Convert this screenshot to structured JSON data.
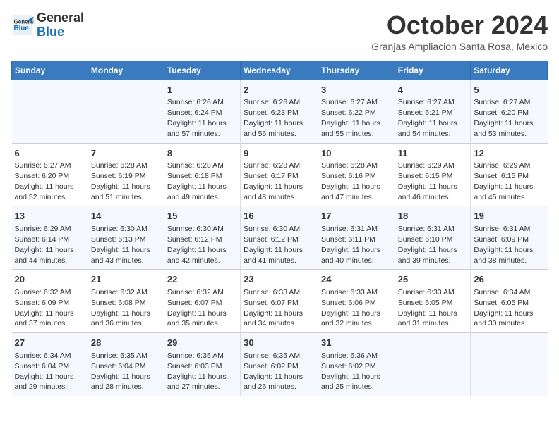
{
  "header": {
    "logo_line1": "General",
    "logo_line2": "Blue",
    "month": "October 2024",
    "location": "Granjas Ampliacion Santa Rosa, Mexico"
  },
  "weekdays": [
    "Sunday",
    "Monday",
    "Tuesday",
    "Wednesday",
    "Thursday",
    "Friday",
    "Saturday"
  ],
  "rows": [
    [
      {
        "day": "",
        "text": ""
      },
      {
        "day": "",
        "text": ""
      },
      {
        "day": "1",
        "text": "Sunrise: 6:26 AM\nSunset: 6:24 PM\nDaylight: 11 hours and 57 minutes."
      },
      {
        "day": "2",
        "text": "Sunrise: 6:26 AM\nSunset: 6:23 PM\nDaylight: 11 hours and 56 minutes."
      },
      {
        "day": "3",
        "text": "Sunrise: 6:27 AM\nSunset: 6:22 PM\nDaylight: 11 hours and 55 minutes."
      },
      {
        "day": "4",
        "text": "Sunrise: 6:27 AM\nSunset: 6:21 PM\nDaylight: 11 hours and 54 minutes."
      },
      {
        "day": "5",
        "text": "Sunrise: 6:27 AM\nSunset: 6:20 PM\nDaylight: 11 hours and 53 minutes."
      }
    ],
    [
      {
        "day": "6",
        "text": "Sunrise: 6:27 AM\nSunset: 6:20 PM\nDaylight: 11 hours and 52 minutes."
      },
      {
        "day": "7",
        "text": "Sunrise: 6:28 AM\nSunset: 6:19 PM\nDaylight: 11 hours and 51 minutes."
      },
      {
        "day": "8",
        "text": "Sunrise: 6:28 AM\nSunset: 6:18 PM\nDaylight: 11 hours and 49 minutes."
      },
      {
        "day": "9",
        "text": "Sunrise: 6:28 AM\nSunset: 6:17 PM\nDaylight: 11 hours and 48 minutes."
      },
      {
        "day": "10",
        "text": "Sunrise: 6:28 AM\nSunset: 6:16 PM\nDaylight: 11 hours and 47 minutes."
      },
      {
        "day": "11",
        "text": "Sunrise: 6:29 AM\nSunset: 6:15 PM\nDaylight: 11 hours and 46 minutes."
      },
      {
        "day": "12",
        "text": "Sunrise: 6:29 AM\nSunset: 6:15 PM\nDaylight: 11 hours and 45 minutes."
      }
    ],
    [
      {
        "day": "13",
        "text": "Sunrise: 6:29 AM\nSunset: 6:14 PM\nDaylight: 11 hours and 44 minutes."
      },
      {
        "day": "14",
        "text": "Sunrise: 6:30 AM\nSunset: 6:13 PM\nDaylight: 11 hours and 43 minutes."
      },
      {
        "day": "15",
        "text": "Sunrise: 6:30 AM\nSunset: 6:12 PM\nDaylight: 11 hours and 42 minutes."
      },
      {
        "day": "16",
        "text": "Sunrise: 6:30 AM\nSunset: 6:12 PM\nDaylight: 11 hours and 41 minutes."
      },
      {
        "day": "17",
        "text": "Sunrise: 6:31 AM\nSunset: 6:11 PM\nDaylight: 11 hours and 40 minutes."
      },
      {
        "day": "18",
        "text": "Sunrise: 6:31 AM\nSunset: 6:10 PM\nDaylight: 11 hours and 39 minutes."
      },
      {
        "day": "19",
        "text": "Sunrise: 6:31 AM\nSunset: 6:09 PM\nDaylight: 11 hours and 38 minutes."
      }
    ],
    [
      {
        "day": "20",
        "text": "Sunrise: 6:32 AM\nSunset: 6:09 PM\nDaylight: 11 hours and 37 minutes."
      },
      {
        "day": "21",
        "text": "Sunrise: 6:32 AM\nSunset: 6:08 PM\nDaylight: 11 hours and 36 minutes."
      },
      {
        "day": "22",
        "text": "Sunrise: 6:32 AM\nSunset: 6:07 PM\nDaylight: 11 hours and 35 minutes."
      },
      {
        "day": "23",
        "text": "Sunrise: 6:33 AM\nSunset: 6:07 PM\nDaylight: 11 hours and 34 minutes."
      },
      {
        "day": "24",
        "text": "Sunrise: 6:33 AM\nSunset: 6:06 PM\nDaylight: 11 hours and 32 minutes."
      },
      {
        "day": "25",
        "text": "Sunrise: 6:33 AM\nSunset: 6:05 PM\nDaylight: 11 hours and 31 minutes."
      },
      {
        "day": "26",
        "text": "Sunrise: 6:34 AM\nSunset: 6:05 PM\nDaylight: 11 hours and 30 minutes."
      }
    ],
    [
      {
        "day": "27",
        "text": "Sunrise: 6:34 AM\nSunset: 6:04 PM\nDaylight: 11 hours and 29 minutes."
      },
      {
        "day": "28",
        "text": "Sunrise: 6:35 AM\nSunset: 6:04 PM\nDaylight: 11 hours and 28 minutes."
      },
      {
        "day": "29",
        "text": "Sunrise: 6:35 AM\nSunset: 6:03 PM\nDaylight: 11 hours and 27 minutes."
      },
      {
        "day": "30",
        "text": "Sunrise: 6:35 AM\nSunset: 6:02 PM\nDaylight: 11 hours and 26 minutes."
      },
      {
        "day": "31",
        "text": "Sunrise: 6:36 AM\nSunset: 6:02 PM\nDaylight: 11 hours and 25 minutes."
      },
      {
        "day": "",
        "text": ""
      },
      {
        "day": "",
        "text": ""
      }
    ]
  ]
}
